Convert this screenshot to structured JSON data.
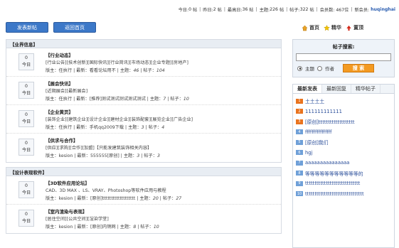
{
  "stats": {
    "today_label": "今日:",
    "today_value": "0",
    "today_unit": "帖",
    "yesterday_label": "昨日:",
    "yesterday_value": "2",
    "yesterday_unit": "帖",
    "max_label": "最高日:",
    "max_value": "36",
    "max_unit": "帖",
    "topics_label": "主题:",
    "topics_value": "226",
    "topics_unit": "帖",
    "posts_label": "帖子:",
    "posts_value": "322",
    "posts_unit": "帖",
    "members_label": "会员数:",
    "members_value": "467位",
    "newest_label": "新会员:",
    "newest_value": "huqinghai"
  },
  "buttons": {
    "new_post": "发表新帖",
    "back_home": "返回首页"
  },
  "toolbar": {
    "home": "首页",
    "elite": "精华",
    "top": "置顶"
  },
  "sections": [
    {
      "title": "【业界信息】",
      "forums": [
        {
          "count": "0",
          "period": "今日",
          "title": "【行业动态】",
          "sub": "[行业公告][技术创新][国际快讯][行业简讯][市场动态][企业专题][房地产]",
          "mod": "版主：任执行",
          "latest_label": "最新：",
          "latest": "看看论坛用不",
          "topics_label": "主题：",
          "topics": "46",
          "posts_label": "帖子：",
          "posts": "104"
        },
        {
          "count": "0",
          "period": "今日",
          "title": "【展会快讯】",
          "sub": "[近期展会][最新展会]",
          "mod": "版主：任执行",
          "latest_label": "最新：",
          "latest": "[推荐]测试测试测试测试测试",
          "topics_label": "主题：",
          "topics": "7",
          "posts_label": "帖子：",
          "posts": "10"
        },
        {
          "count": "0",
          "period": "今日",
          "title": "【企业黄页】",
          "sub": "[装饰企业][建筑企业][设计企业][建材企业][装饰配套][展览企业][广告企业]",
          "mod": "版主：任执行",
          "latest_label": "最新：",
          "latest": "手机qq2009下载",
          "topics_label": "主题：",
          "topics": "3",
          "posts_label": "帖子：",
          "posts": "4"
        },
        {
          "count": "0",
          "period": "今日",
          "title": "【供求与合作】",
          "sub": "[供应][求购][合作][加盟]【只能发建筑装饰相关内容】",
          "mod": "版主：kesion",
          "latest_label": "最新：",
          "latest": "555555[原创]",
          "topics_label": "主题：",
          "topics": "3",
          "posts_label": "帖子：",
          "posts": "3"
        }
      ]
    },
    {
      "title": "【设计表现软件】",
      "forums": [
        {
          "count": "0",
          "period": "今日",
          "title": "【3D软件应用论坛】",
          "sub": "CAD、3D MAX 、LS、VRAY、Photoshop等软件应用与教程",
          "mod": "版主：kesion",
          "latest_label": "最新：",
          "latest": "[原创]ttttttttttttttttttt",
          "topics_label": "主题：",
          "topics": "20",
          "posts_label": "帖子：",
          "posts": "27"
        },
        {
          "count": "0",
          "period": "今日",
          "title": "【室内渲染与表现】",
          "sub": "[居住空间][公共空间][渲染学堂]",
          "mod": "版主：kesion",
          "latest_label": "最新：",
          "latest": "[原创]内销网",
          "topics_label": "主题：",
          "topics": "8",
          "posts_label": "帖子：",
          "posts": "10"
        }
      ]
    }
  ],
  "search": {
    "title": "帖子搜索:",
    "opt_topic": "主题",
    "opt_author": "作者",
    "button": "搜  索"
  },
  "tabs": [
    "最新发表",
    "最新回复",
    "精华帖子"
  ],
  "latest": [
    {
      "n": "1",
      "text": "土土土土"
    },
    {
      "n": "2",
      "text": "111111111111"
    },
    {
      "n": "3",
      "text": "[原创]ttttttttttttttttttt"
    },
    {
      "n": "4",
      "text": "ffffffffffffffff"
    },
    {
      "n": "5",
      "text": "[原创]我们"
    },
    {
      "n": "6",
      "text": "hgj"
    },
    {
      "n": "7",
      "text": "aaaaaaaaaaaaaaa"
    },
    {
      "n": "8",
      "text": "等等等等等等等等等等等的"
    },
    {
      "n": "9",
      "text": "ttttttttttttttttttttttttttttt"
    },
    {
      "n": "10",
      "text": "ttttttttttttttttttttttttttttttt"
    }
  ],
  "colors": {
    "accent": "#3c78c8",
    "search_button": "#f39a22",
    "link": "#2a4e9a"
  }
}
